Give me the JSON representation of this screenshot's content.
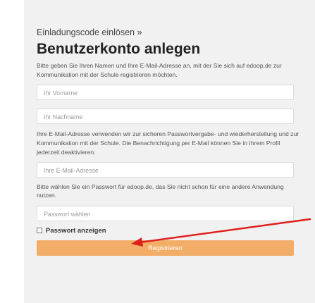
{
  "breadcrumb": "Einladungscode einlösen »",
  "title": "Benutzerkonto anlegen",
  "intro_text": "Bitte geben Sie Ihren Namen und Ihre E-Mail-Adresse an, mit der Sie sich auf edoop.de zur Kommunikation mit der Schule registrieren möchten.",
  "first_name_placeholder": "Ihr Vorname",
  "last_name_placeholder": "Ihr Nachname",
  "email_info_text": "Ihre E-Mail-Adresse verwenden wir zur sicheren Passwortvergabe- und wiederherstellung und zur Kommunikation mit der Schule. Die Benachrichtigung per E-Mail können Sie in Ihrem Profil jederzeit deaktivieren.",
  "email_placeholder": "Ihre E-Mail-Adresse",
  "password_info_text": "Bitte wählen Sie ein Passwort für edoop.de, das Sie nicht schon für eine andere Anwendung nutzen.",
  "password_placeholder": "Passwort wählen",
  "show_password_label": "Passwort anzeigen",
  "register_button_label": "Registrieren",
  "colors": {
    "accent": "#f2ae68",
    "arrow": "#e0201c",
    "panel": "#f1f1f1"
  }
}
